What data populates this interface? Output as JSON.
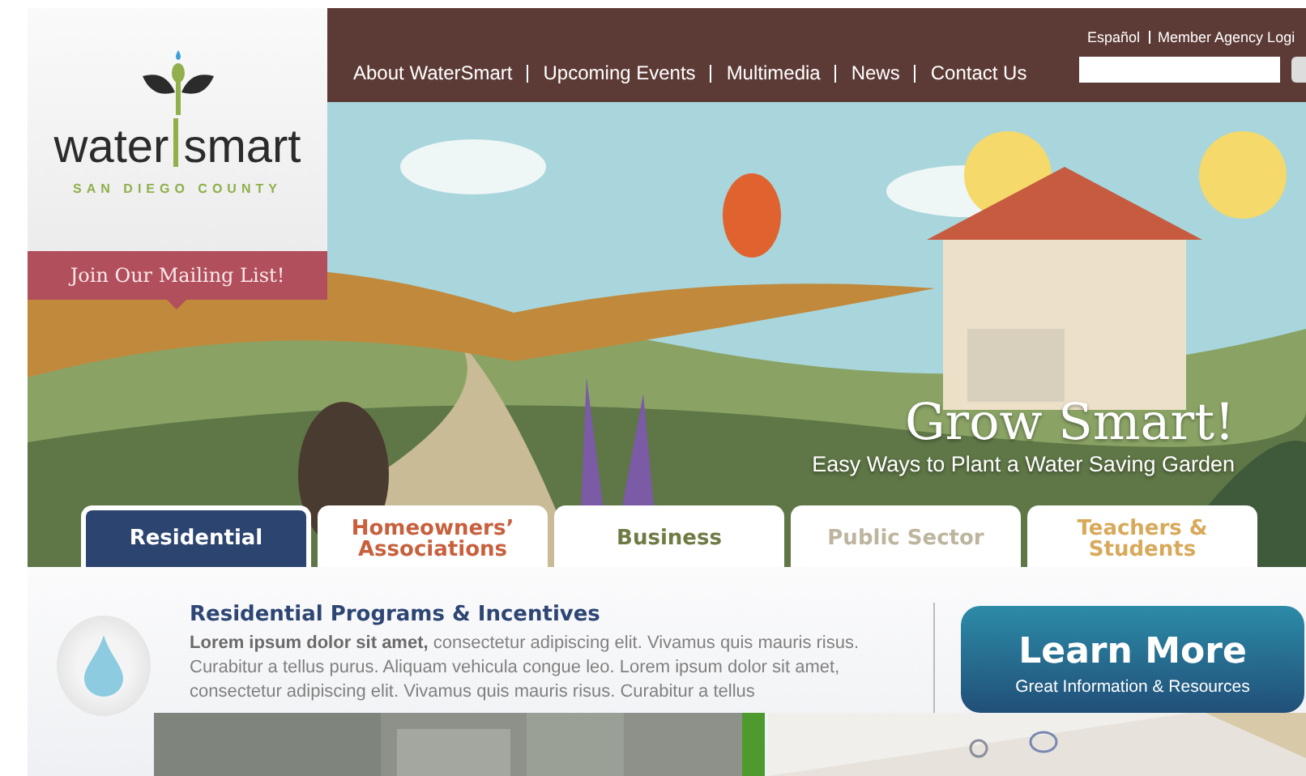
{
  "logo": {
    "word_left": "water",
    "word_right": "smart",
    "tagline": "SAN DIEGO COUNTY"
  },
  "mailing_list": "Join Our Mailing List!",
  "utility_links": [
    "Español",
    "Member Agency Logi"
  ],
  "nav": [
    "About WaterSmart",
    "Upcoming Events",
    "Multimedia",
    "News",
    "Contact Us"
  ],
  "hero": {
    "title": "Grow Smart!",
    "subtitle": "Easy Ways to Plant a Water Saving Garden"
  },
  "tabs": [
    {
      "label": "Residential",
      "selected": true,
      "color": "#2b4470"
    },
    {
      "label": "Homeowners’ Associations",
      "selected": false,
      "color": "#c8603e"
    },
    {
      "label": "Business",
      "selected": false,
      "color": "#6e7b45"
    },
    {
      "label": "Public Sector",
      "selected": false,
      "color": "#bdb59f"
    },
    {
      "label": "Teachers & Students",
      "selected": false,
      "color": "#d8a95a"
    }
  ],
  "section": {
    "title": "Residential Programs & Incentives",
    "body": "**Lorem ipsum dolor sit amet,** consectetur adipiscing elit. Vivamus quis mauris risus. Curabitur a tellus purus. Aliquam vehicula congue leo. Lorem ipsum dolor sit amet, consectetur adipiscing elit. Vivamus quis mauris risus. Curabitur a tellus"
  },
  "cta": {
    "title": "Learn More",
    "subtitle": "Great Information & Resources"
  }
}
